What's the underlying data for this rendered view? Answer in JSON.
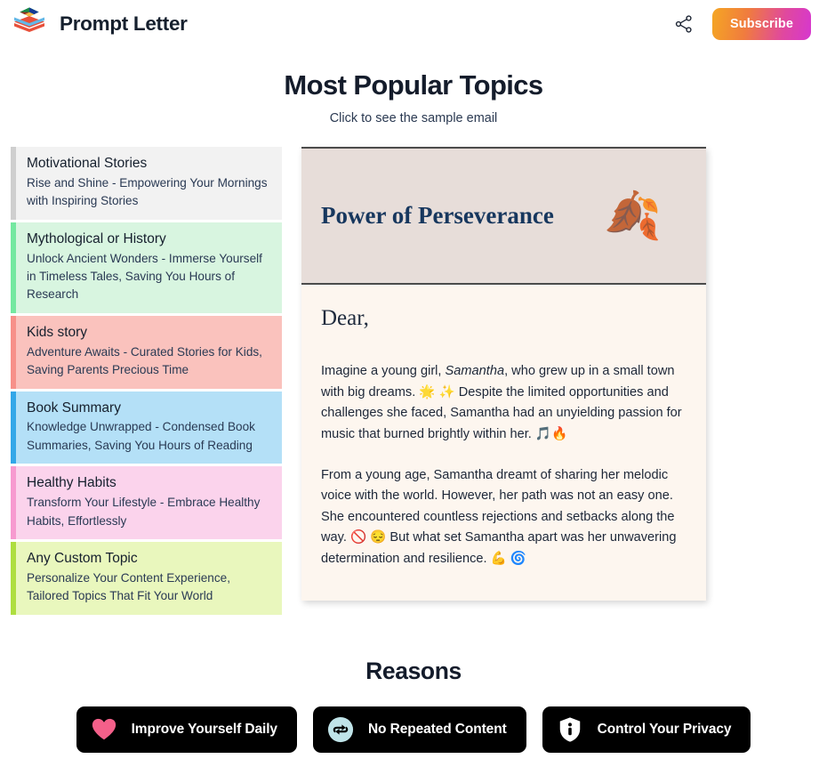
{
  "header": {
    "brand_name": "Prompt Letter",
    "logo_icon": "layers-stack-icon",
    "share_icon": "share-network-icon",
    "subscribe_label": "Subscribe",
    "accent_gradient_from": "#f5a623",
    "accent_gradient_to": "#d637cf"
  },
  "page": {
    "title": "Most Popular Topics",
    "subtitle": "Click to see the sample email",
    "reasons_title": "Reasons"
  },
  "topics": [
    {
      "title": "Motivational Stories",
      "desc": "Rise and Shine - Empowering Your Mornings with Inspiring Stories",
      "bg": "#f2f2f2",
      "accent": "#cfcfcf"
    },
    {
      "title": "Mythological or History",
      "desc": "Unlock Ancient Wonders - Immerse Yourself in Timeless Tales, Saving You Hours of Research",
      "bg": "#d8f5e0",
      "accent": "#74e8a0"
    },
    {
      "title": "Kids story",
      "desc": "Adventure Awaits - Curated Stories for Kids, Saving Parents Precious Time",
      "bg": "#fac2bd",
      "accent": "#f79089"
    },
    {
      "title": "Book Summary",
      "desc": "Knowledge Unwrapped - Condensed Book Summaries, Saving You Hours of Reading",
      "bg": "#b4e0f7",
      "accent": "#33a7e8"
    },
    {
      "title": "Healthy Habits",
      "desc": "Transform Your Lifestyle - Embrace Healthy Habits, Effortlessly",
      "bg": "#fbd3ec",
      "accent": "#f79ad0"
    },
    {
      "title": "Any Custom Topic",
      "desc": "Personalize Your Content Experience, Tailored Topics That Fit Your World",
      "bg": "#e9f7bd",
      "accent": "#aede3f"
    }
  ],
  "email": {
    "header_title": "Power of Perseverance",
    "header_emoji": "🍂",
    "header_emoji_name": "fallen-leaves-emoji",
    "header_bg": "#e7ddd9",
    "body_bg": "#fdf6ef",
    "title_color": "#17375e",
    "greeting": "Dear,",
    "paragraph_1_pre": "Imagine a young girl, ",
    "paragraph_1_em": "Samantha",
    "paragraph_1_post": ", who grew up in a small town with big dreams. 🌟 ✨ Despite the limited opportunities and challenges she faced, Samantha had an unyielding passion for music that burned brightly within her. 🎵🔥",
    "paragraph_2": "From a young age, Samantha dreamt of sharing her melodic voice with the world. However, her path was not an easy one. She encountered countless rejections and setbacks along the way. 🚫 😔 But what set Samantha apart was her unwavering determination and resilience. 💪 🌀"
  },
  "reasons": [
    {
      "label": "Improve Yourself Daily",
      "icon": "heart-icon",
      "icon_color": "#f4608a"
    },
    {
      "label": "No Repeated Content",
      "icon": "refresh-cycle-icon",
      "icon_color": "#bfe3e8"
    },
    {
      "label": "Control Your Privacy",
      "icon": "shield-info-icon",
      "icon_color": "#ffffff"
    }
  ]
}
